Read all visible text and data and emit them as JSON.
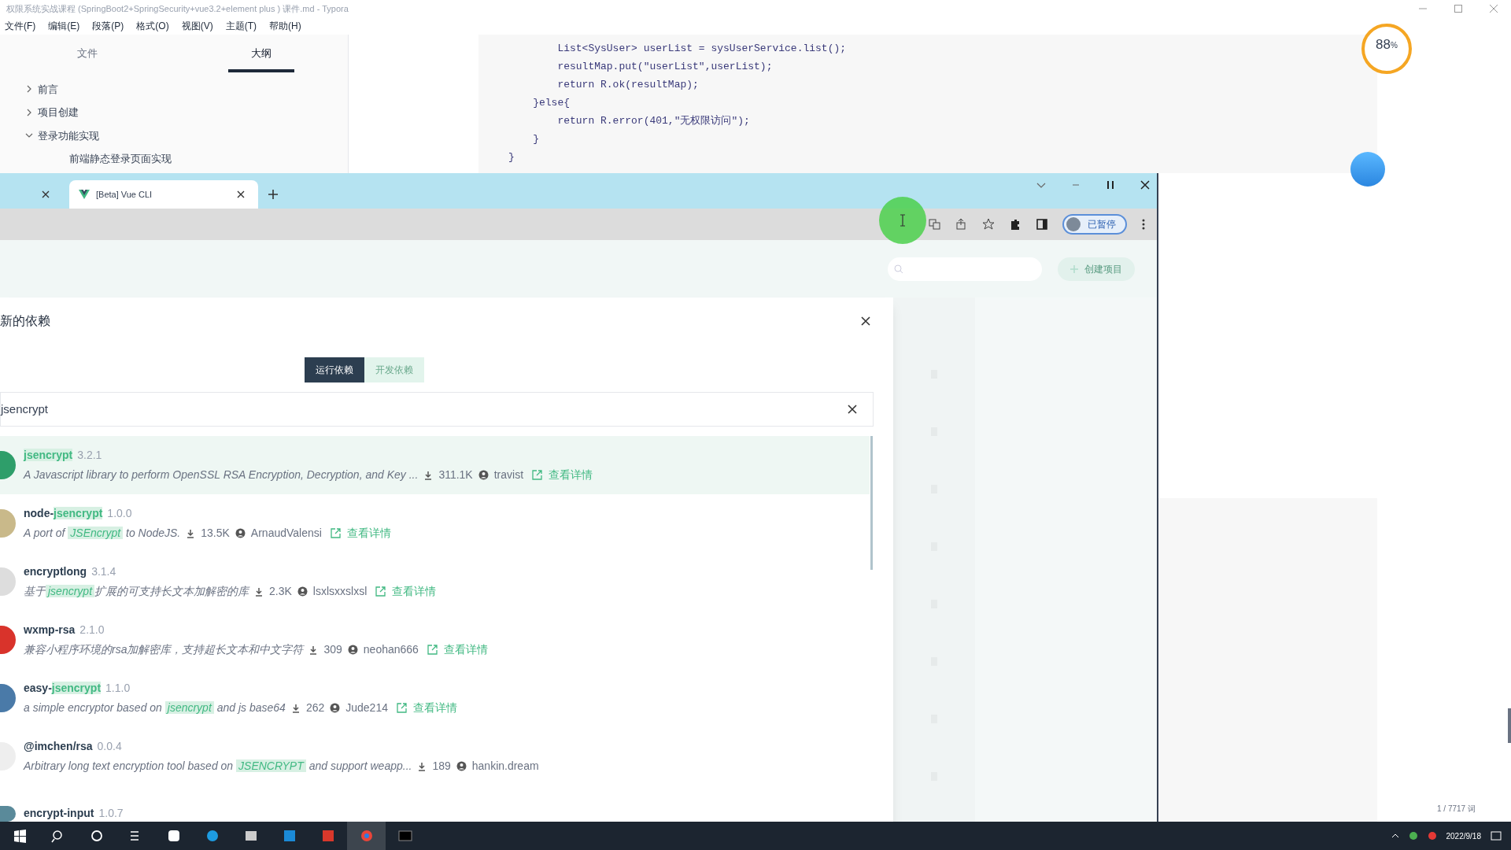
{
  "typora": {
    "title": "权限系统实战课程 (SpringBoot2+SpringSecurity+vue3.2+element plus ) 课件.md - Typora",
    "menu": [
      "文件(F)",
      "编辑(E)",
      "段落(P)",
      "格式(O)",
      "视图(V)",
      "主题(T)",
      "帮助(H)"
    ],
    "sidebar_tabs": [
      {
        "label": "文件",
        "selected": false
      },
      {
        "label": "大纲",
        "selected": true
      }
    ],
    "outline": [
      {
        "label": "前言",
        "expanded": false
      },
      {
        "label": "项目创建",
        "expanded": false
      },
      {
        "label": "登录功能实现",
        "expanded": true,
        "children": [
          {
            "label": "前端静态登录页面实现"
          }
        ]
      }
    ],
    "code_lines": [
      "        List<SysUser> userList = sysUserService.list();",
      "        resultMap.put(\"userList\",userList);",
      "        return R.ok(resultMap);",
      "    }else{",
      "        return R.error(401,\"无权限访问\");",
      "    }",
      "}"
    ],
    "word_count": "1 / 7717 词"
  },
  "widget": {
    "percent": "88",
    "unit": "%"
  },
  "browser": {
    "tabs": [
      {
        "selected": false
      },
      {
        "label": "[Beta] Vue CLI",
        "selected": true
      }
    ],
    "profile_label": "已暂停",
    "create_button": "创建项目",
    "dialog": {
      "title": "新的依赖",
      "type_tabs": [
        {
          "label": "运行依赖",
          "selected": true
        },
        {
          "label": "开发依赖",
          "selected": false
        }
      ],
      "search": {
        "value": "jsencrypt"
      },
      "packages": [
        {
          "name": [
            {
              "text": "jsencrypt",
              "match": true
            }
          ],
          "version": "3.2.1",
          "description": [
            {
              "text": "A Javascript library to perform OpenSSL RSA Encryption, Decryption, and Key ...",
              "match": false
            }
          ],
          "downloads": "311.1K",
          "author": "travist",
          "details": "查看详情",
          "selected": true,
          "color": "#2e9e6a"
        },
        {
          "name": [
            {
              "text": "node-",
              "match": false
            },
            {
              "text": "jsencrypt",
              "match": true
            }
          ],
          "version": "1.0.0",
          "description": [
            {
              "text": "A port of ",
              "match": false
            },
            {
              "text": "JSEncrypt",
              "match": true
            },
            {
              "text": " to NodeJS.",
              "match": false
            }
          ],
          "downloads": "13.5K",
          "author": "ArnaudValensi",
          "details": "查看详情",
          "selected": false,
          "color": "#c9b98a"
        },
        {
          "name": [
            {
              "text": "encryptlong",
              "match": false
            }
          ],
          "version": "3.1.4",
          "description": [
            {
              "text": "基于",
              "match": false
            },
            {
              "text": "jsencrypt",
              "match": true
            },
            {
              "text": "扩展的可支持长文本加解密的库",
              "match": false
            }
          ],
          "downloads": "2.3K",
          "author": "lsxlsxxslxsl",
          "details": "查看详情",
          "selected": false,
          "color": "#dddddd"
        },
        {
          "name": [
            {
              "text": "wxmp-rsa",
              "match": false
            }
          ],
          "version": "2.1.0",
          "description": [
            {
              "text": "兼容小程序环境的rsa加解密库，支持超长文本和中文字符",
              "match": false
            }
          ],
          "downloads": "309",
          "author": "neohan666",
          "details": "查看详情",
          "selected": false,
          "color": "#d9332b"
        },
        {
          "name": [
            {
              "text": "easy-",
              "match": false
            },
            {
              "text": "jsencrypt",
              "match": true
            }
          ],
          "version": "1.1.0",
          "description": [
            {
              "text": "a simple encryptor based on ",
              "match": false
            },
            {
              "text": "jsencrypt",
              "match": true
            },
            {
              "text": " and js base64",
              "match": false
            }
          ],
          "downloads": "262",
          "author": "Jude214",
          "details": "查看详情",
          "selected": false,
          "color": "#4a7aa8"
        },
        {
          "name": [
            {
              "text": "@imchen/rsa",
              "match": false
            }
          ],
          "version": "0.0.4",
          "description": [
            {
              "text": "Arbitrary long text encryption tool based on ",
              "match": false
            },
            {
              "text": "JSENCRYPT",
              "match": true
            },
            {
              "text": " and support weapp...",
              "match": false
            }
          ],
          "downloads": "189",
          "author": "hankin.dream",
          "selected": false,
          "color": "#eeeeee"
        },
        {
          "name": [
            {
              "text": "encrypt-input",
              "match": false
            }
          ],
          "version": "1.0.7",
          "selected": false,
          "color": "#5a8a9a"
        }
      ]
    }
  },
  "taskbar": {
    "date": "2022/9/18"
  }
}
